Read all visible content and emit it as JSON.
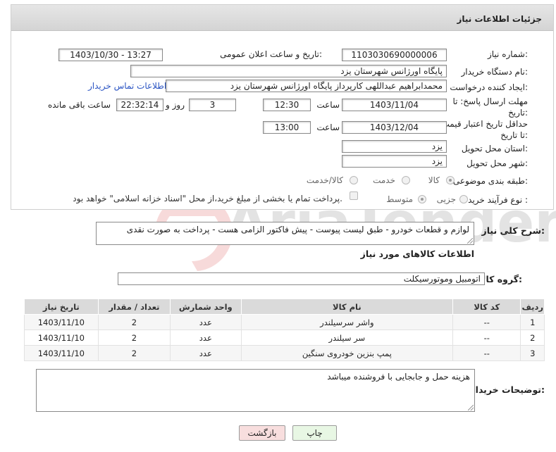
{
  "header": {
    "title": "جزئیات اطلاعات نیاز"
  },
  "fields": {
    "need_number_label": "شماره نیاز:",
    "need_number": "1103030690000006",
    "announce_label": "تاریخ و ساعت اعلان عمومی:",
    "announce_value": "1403/10/30 - 13:27",
    "buyer_org_label": "نام دستگاه خریدار:",
    "buyer_org": "پایگاه اورژانس شهرستان یزد",
    "requester_label": "ایجاد کننده درخواست:",
    "requester": "محمدابراهیم عبداللهی کارپرداز پایگاه اورژانس شهرستان یزد",
    "contact_link": "اطلاعات تماس خریدار",
    "reply_deadline_label": "مهلت ارسال پاسخ: تا تاریخ:",
    "reply_date": "1403/11/04",
    "reply_time_label": "ساعت",
    "reply_time": "12:30",
    "days_value": "3",
    "days_label": "روز و",
    "remaining_time": "22:32:14",
    "remaining_label": "ساعت باقی مانده",
    "price_validity_label": "حداقل تاریخ اعتبار قیمت: تا تاریخ:",
    "price_date": "1403/12/04",
    "price_time_label": "ساعت",
    "price_time": "13:00",
    "province_label": "استان محل تحویل:",
    "province": "یزد",
    "city_label": "شهر محل تحویل:",
    "city": "یزد",
    "category_label": "طبقه بندی موضوعی:",
    "category_options": [
      "کالا",
      "خدمت",
      "کالا/خدمت"
    ],
    "process_label": "نوع فرآیند خرید :",
    "process_options": [
      "جزیی",
      "متوسط"
    ],
    "payment_note": "پرداخت تمام یا بخشی از مبلغ خرید،از محل \"اسناد خزانه اسلامی\" خواهد بود."
  },
  "description": {
    "label": "شرح کلی نیاز:",
    "text": "لوازم و قطعات خودرو - طبق لیست پیوست - پیش فاکتور الزامی هست - پرداخت به صورت نقدی"
  },
  "goods_section": {
    "title": "اطلاعات کالاهای مورد نیاز",
    "group_label": "گروه کالا:",
    "group_value": "اتومبیل وموتورسیکلت"
  },
  "table": {
    "headers": [
      "ردیف",
      "کد کالا",
      "نام کالا",
      "واحد شمارش",
      "تعداد / مقدار",
      "تاریخ نیاز"
    ],
    "rows": [
      [
        "1",
        "--",
        "واشر سرسیلندر",
        "عدد",
        "2",
        "1403/11/10"
      ],
      [
        "2",
        "--",
        "سر سیلندر",
        "عدد",
        "2",
        "1403/11/10"
      ],
      [
        "3",
        "--",
        "پمپ بنزین خودروی سنگین",
        "عدد",
        "2",
        "1403/11/10"
      ]
    ]
  },
  "buyer_notes": {
    "label": "توضیحات خریدار:",
    "text": "هزینه حمل و جابجایی با فروشنده میباشد"
  },
  "buttons": {
    "print": "چاپ",
    "back": "بازگشت"
  },
  "watermark": {
    "text": "AriaTender.net"
  },
  "colors": {
    "link": "#2a54c3",
    "print_btn": "#e8f7e4",
    "back_btn": "#f8dede",
    "header_bg": "#dcdcdc"
  }
}
